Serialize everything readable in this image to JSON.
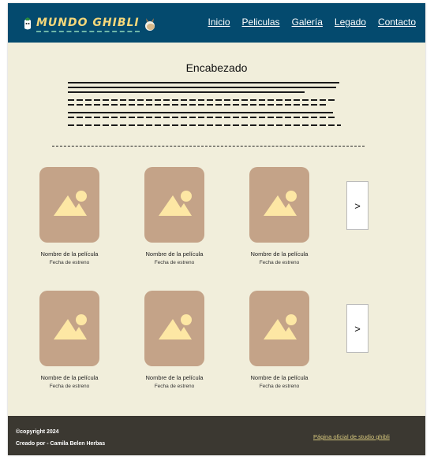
{
  "header": {
    "logo_text": "MUNDO GHIBLI",
    "nav": [
      "Inicio",
      "Peliculas",
      "Galería",
      "Legado",
      "Contacto"
    ]
  },
  "main": {
    "title": "Encabezado"
  },
  "cards": {
    "name": "Nombre de la película",
    "date": "Fecha de estreno"
  },
  "next_label": ">",
  "footer": {
    "copyright": "©copyright 2024",
    "credit": "Creado por - Camila Belen Herbas",
    "official_link": "Página oficial de studio ghibli"
  },
  "colors": {
    "header_bg": "#044a6e",
    "page_bg": "#f1eedb",
    "card_bg": "#c4a388",
    "image_icon": "#fde7a4",
    "footer_bg": "#3b3831"
  }
}
